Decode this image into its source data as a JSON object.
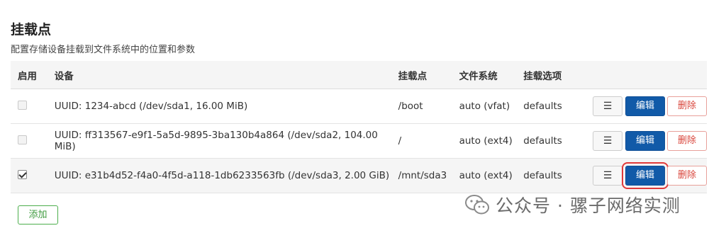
{
  "page": {
    "title": "挂载点",
    "description": "配置存储设备挂载到文件系统中的位置和参数"
  },
  "table": {
    "headers": {
      "enabled": "启用",
      "device": "设备",
      "mountpoint": "挂载点",
      "filesystem": "文件系统",
      "options": "挂载选项"
    },
    "rows": [
      {
        "enabled": false,
        "device": "UUID: 1234-abcd (/dev/sda1, 16.00 MiB)",
        "mountpoint": "/boot",
        "filesystem": "auto (vfat)",
        "options": "defaults"
      },
      {
        "enabled": false,
        "device": "UUID: ff313567-e9f1-5a5d-9895-3ba130b4a864 (/dev/sda2, 104.00 MiB)",
        "mountpoint": "/",
        "filesystem": "auto (ext4)",
        "options": "defaults"
      },
      {
        "enabled": true,
        "device": "UUID: e31b4d52-f4a0-4f5d-a118-1db6233563fb (/dev/sda3, 2.00 GiB)",
        "mountpoint": "/mnt/sda3",
        "filesystem": "auto (ext4)",
        "options": "defaults"
      }
    ]
  },
  "buttons": {
    "menu_glyph": "☰",
    "edit": "编辑",
    "delete": "删除",
    "add": "添加"
  },
  "highlight_color": "#e03a3a",
  "watermark": {
    "text": "公众号 · 骡子网络实测",
    "icon": "wechat-icon"
  }
}
